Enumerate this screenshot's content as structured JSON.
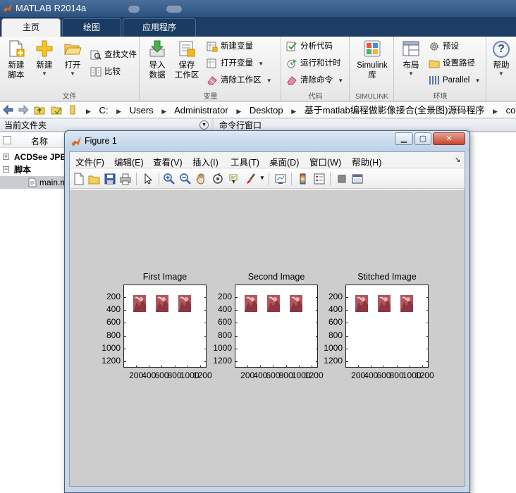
{
  "window": {
    "title": "MATLAB R2014a"
  },
  "ribbon_tabs": [
    {
      "label": "主页",
      "active": true
    },
    {
      "label": "绘图",
      "active": false
    },
    {
      "label": "应用程序",
      "active": false
    }
  ],
  "ribbon": {
    "file": {
      "label": "文件",
      "new_script": "新建\n脚本",
      "new": "新建",
      "open": "打开",
      "find_files": "查找文件",
      "compare": "比较"
    },
    "variable": {
      "label": "变量",
      "import": "导入\n数据",
      "save_workspace": "保存\n工作区",
      "new_variable": "新建变量",
      "open_variable": "打开变量",
      "clear_workspace": "清除工作区"
    },
    "code": {
      "label": "代码",
      "analyze": "分析代码",
      "run_time": "运行和计时",
      "clear_commands": "清除命令"
    },
    "simulink": {
      "label": "SIMULINK",
      "library": "Simulink\n库"
    },
    "environment": {
      "label": "环境",
      "layout": "布局",
      "preferences": "预设",
      "set_path": "设置路径",
      "parallel": "Parallel"
    },
    "help": "帮助"
  },
  "address": {
    "crumbs": [
      "C:",
      "Users",
      "Administrator",
      "Desktop",
      "基于matlab编程做影像接合(全景图)源码程序",
      "code"
    ]
  },
  "panels": {
    "current_folder": "当前文件夹",
    "command_window": "命令行窗口",
    "name_column": "名称",
    "tree": [
      {
        "label": "ACDSee JPE",
        "bold": true,
        "expander": "+"
      },
      {
        "label": "脚本",
        "bold": true,
        "expander": "−"
      }
    ],
    "selected_file": "main.m"
  },
  "figure": {
    "title": "Figure 1",
    "menus": [
      "文件(F)",
      "编辑(E)",
      "查看(V)",
      "插入(I)",
      "工具(T)",
      "桌面(D)",
      "窗口(W)",
      "帮助(H)"
    ],
    "axes": [
      {
        "title": "First Image"
      },
      {
        "title": "Second Image"
      },
      {
        "title": "Stitched Image"
      }
    ]
  },
  "chart_data": {
    "type": "image",
    "yticks": [
      "200",
      "400",
      "600",
      "800",
      "1000",
      "1200"
    ],
    "xticks": [
      "200",
      "400",
      "600",
      "800",
      "1000",
      "1200"
    ],
    "ylim": [
      0,
      1300
    ],
    "xlim": [
      0,
      1300
    ],
    "thumbnails_per_axes": 3
  },
  "colors": {
    "titlebar": "#2d5180",
    "tab_strip": "#1c3e66",
    "figure_canvas": "#cdcdcd",
    "thumbnail": "#b0555f"
  }
}
